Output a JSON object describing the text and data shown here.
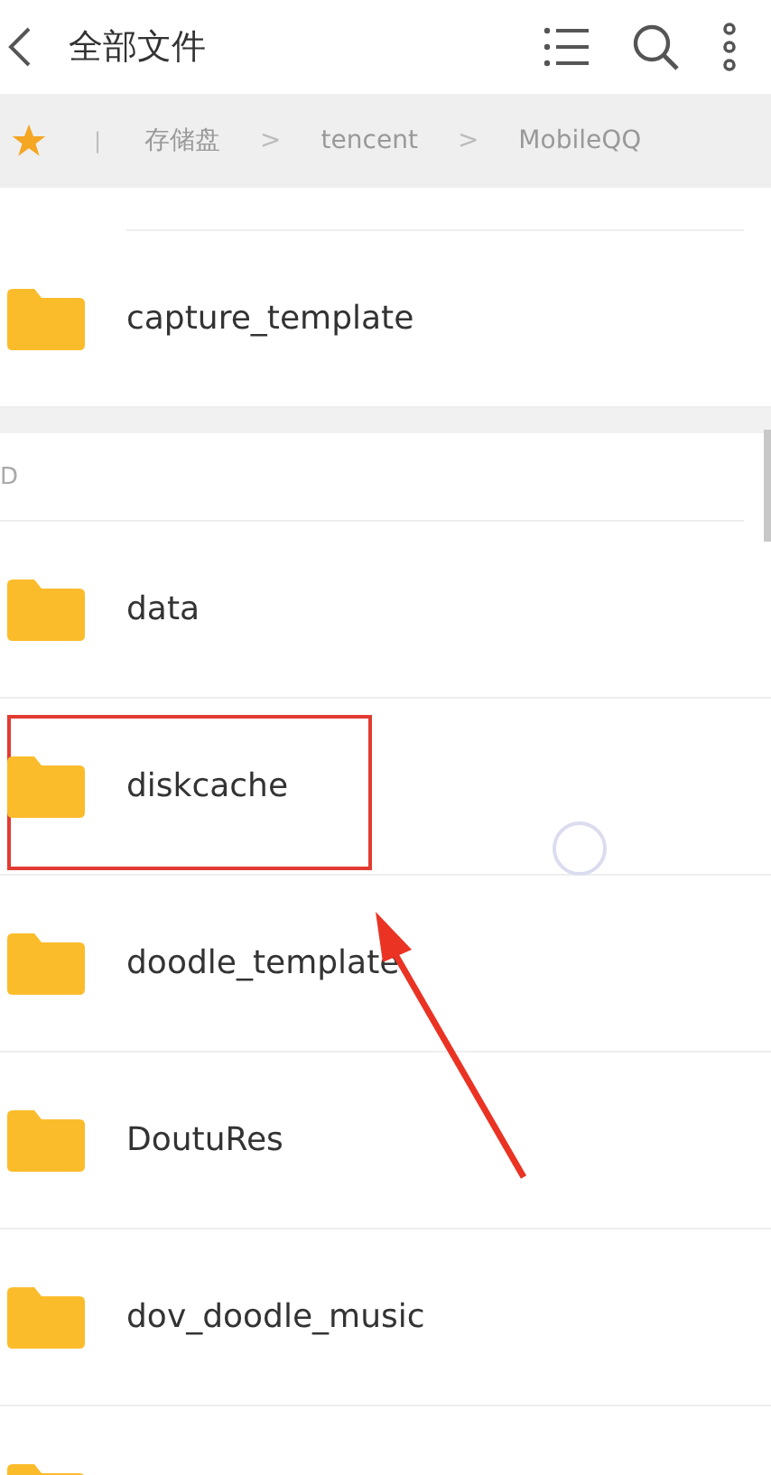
{
  "header": {
    "title": "全部文件"
  },
  "breadcrumb": {
    "starred": true,
    "separator": "|",
    "path_separator": ">",
    "path": [
      "存储盘",
      "tencent",
      "MobileQQ"
    ]
  },
  "groups": [
    {
      "items": [
        {
          "name": "capture_template",
          "highlighted": false
        }
      ]
    },
    {
      "letter": "D",
      "items": [
        {
          "name": "data",
          "highlighted": false
        },
        {
          "name": "diskcache",
          "highlighted": true
        },
        {
          "name": "doodle_template",
          "highlighted": false
        },
        {
          "name": "DoutuRes",
          "highlighted": false
        },
        {
          "name": "dov_doodle_music",
          "highlighted": false
        },
        {
          "highlighted": false
        }
      ]
    }
  ]
}
